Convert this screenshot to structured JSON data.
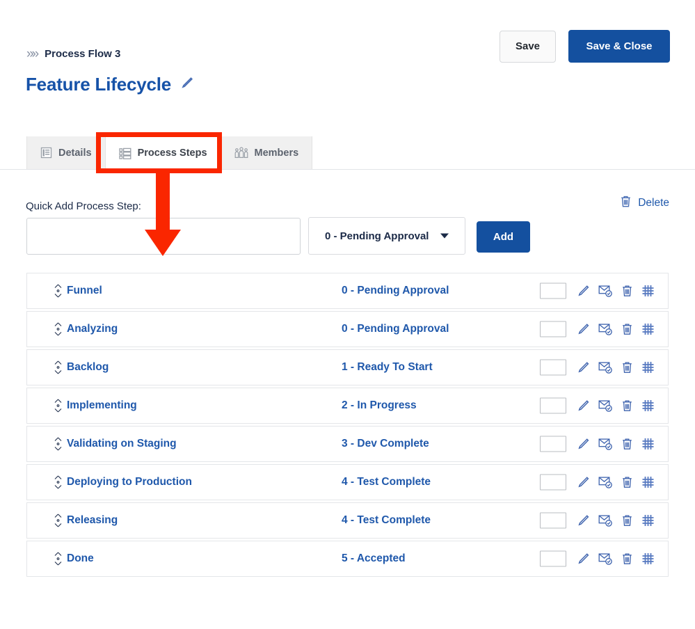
{
  "header": {
    "breadcrumb_icon": "double-chevron-right-icon",
    "breadcrumb": "Process Flow 3",
    "title": "Feature Lifecycle",
    "title_edit_icon": "pencil-icon",
    "save_label": "Save",
    "save_close_label": "Save & Close"
  },
  "tabs": [
    {
      "label": "Details",
      "icon": "document-lines-icon",
      "active": false
    },
    {
      "label": "Process Steps",
      "icon": "list-checkbox-icon",
      "active": true
    },
    {
      "label": "Members",
      "icon": "people-group-icon",
      "active": false
    }
  ],
  "quick_add": {
    "label": "Quick Add Process Step:",
    "input_value": "",
    "input_placeholder": "",
    "status_selected": "0 - Pending Approval",
    "status_options": [
      "0 - Pending Approval",
      "1 - Ready To Start",
      "2 - In Progress",
      "3 - Dev Complete",
      "4 - Test Complete",
      "5 - Accepted"
    ],
    "caret_icon": "chevron-down-icon",
    "add_label": "Add"
  },
  "toolbar": {
    "delete_label": "Delete",
    "delete_icon": "trash-icon"
  },
  "row_icons": {
    "handle": "drag-updown-icon",
    "edit": "pencil-icon",
    "email": "envelope-check-icon",
    "delete": "trash-icon",
    "grid": "grid-hash-icon"
  },
  "rows": [
    {
      "name": "Funnel",
      "status": "0 - Pending Approval",
      "value": ""
    },
    {
      "name": "Analyzing",
      "status": "0 - Pending Approval",
      "value": ""
    },
    {
      "name": "Backlog",
      "status": "1 - Ready To Start",
      "value": ""
    },
    {
      "name": "Implementing",
      "status": "2 - In Progress",
      "value": ""
    },
    {
      "name": "Validating on Staging",
      "status": "3 - Dev Complete",
      "value": ""
    },
    {
      "name": "Deploying to Production",
      "status": "4 - Test Complete",
      "value": ""
    },
    {
      "name": "Releasing",
      "status": "4 - Test Complete",
      "value": ""
    },
    {
      "name": "Done",
      "status": "5 - Accepted",
      "value": ""
    }
  ],
  "annotation": {
    "shape": "red-box-with-down-arrow",
    "target": "Process Steps",
    "color": "#fa2600"
  },
  "colors": {
    "brand_blue": "#14509f",
    "link_blue": "#1f58ab",
    "title_blue": "#1652a8",
    "annotation_red": "#fa2600",
    "text_dark": "#1b2a47"
  }
}
